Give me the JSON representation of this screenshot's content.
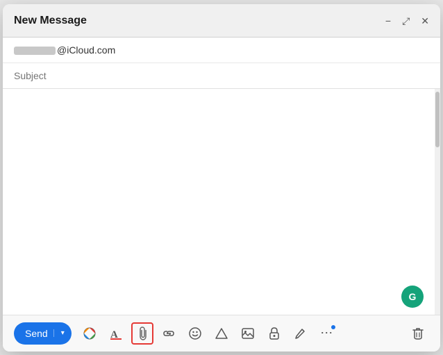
{
  "window": {
    "title": "New Message",
    "controls": {
      "minimize": "−",
      "expand": "⤢",
      "close": "✕"
    }
  },
  "header": {
    "to_placeholder": "@iCloud.com",
    "subject_placeholder": "Subject"
  },
  "body": {
    "placeholder": ""
  },
  "toolbar": {
    "send_label": "Send",
    "send_arrow": "▾",
    "tools": [
      {
        "name": "color-picker",
        "icon": "🎨"
      },
      {
        "name": "format-text",
        "icon": "A"
      },
      {
        "name": "attachment",
        "icon": "📎"
      },
      {
        "name": "link",
        "icon": "🔗"
      },
      {
        "name": "emoji",
        "icon": "😊"
      },
      {
        "name": "drive",
        "icon": "△"
      },
      {
        "name": "photo",
        "icon": "⊞"
      },
      {
        "name": "lock",
        "icon": "🔒"
      },
      {
        "name": "pencil",
        "icon": "✏"
      },
      {
        "name": "more",
        "icon": "⋯"
      },
      {
        "name": "trash",
        "icon": "🗑"
      }
    ]
  },
  "grammarly": {
    "label": "G"
  }
}
